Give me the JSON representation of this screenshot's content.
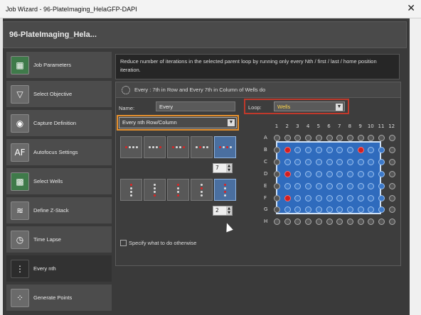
{
  "window": {
    "title": "Job Wizard - 96-PlateImaging_HelaGFP-DAPI",
    "close_glyph": "✕"
  },
  "header": {
    "title": "96-PlateImaging_Hela..."
  },
  "sidebar": {
    "items": [
      {
        "label": "Job Parameters",
        "icon": "job-parameters-icon"
      },
      {
        "label": "Select Objective",
        "icon": "objective-icon"
      },
      {
        "label": "Capture Definition",
        "icon": "camera-icon"
      },
      {
        "label": "Autofocus Settings",
        "icon": "autofocus-icon"
      },
      {
        "label": "Select Wells",
        "icon": "wells-icon"
      },
      {
        "label": "Define Z-Stack",
        "icon": "zstack-icon"
      },
      {
        "label": "Time Lapse",
        "icon": "clock-icon"
      },
      {
        "label": "Every nth",
        "icon": "every-nth-icon"
      },
      {
        "label": "Generate Points",
        "icon": "points-icon"
      }
    ],
    "active_index": 7
  },
  "description": "Reduce number of iterations in the selected parent loop by running only every Nth / first / last / home position iteration.",
  "panel": {
    "title": "Every : 7th in Row and Every 7th in Column of Wells do",
    "name_label": "Name:",
    "name_value": "Every",
    "loop_label": "Loop:",
    "loop_value": "Wells",
    "mode_value": "Every nth Row/Column",
    "row_n": "7",
    "col_n": "2",
    "specify_label": "Specify what to do otherwise",
    "specify_checked": false
  },
  "plate": {
    "columns": [
      "1",
      "2",
      "3",
      "4",
      "5",
      "6",
      "7",
      "8",
      "9",
      "10",
      "11",
      "12"
    ],
    "rows": [
      "A",
      "B",
      "C",
      "D",
      "E",
      "F",
      "G",
      "H"
    ],
    "accent": "#2f6bbd",
    "hit_color": "#d21f1f"
  }
}
